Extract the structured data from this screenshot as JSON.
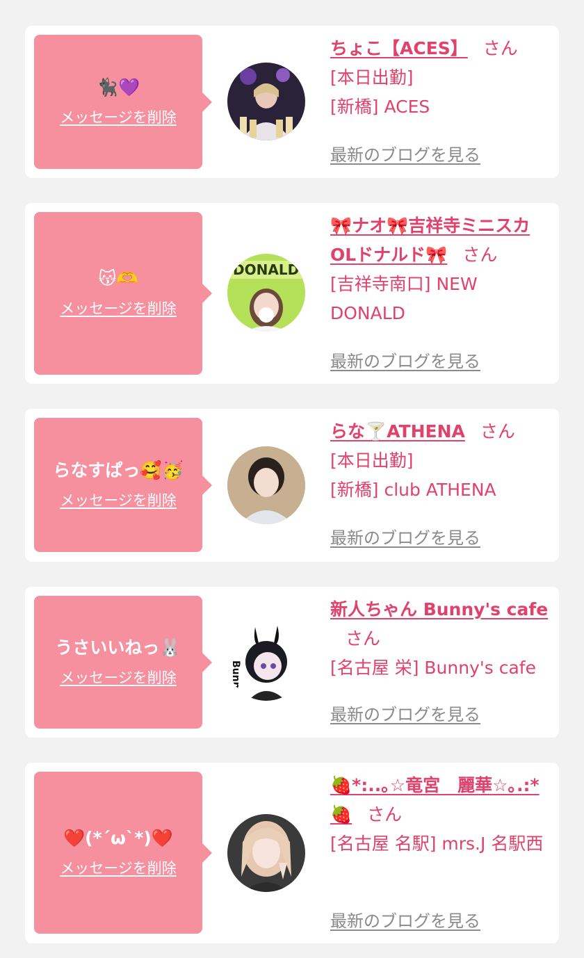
{
  "delete_label": "メッセージを削除",
  "blog_label": "最新のブログを見る",
  "san_label": "さん",
  "cards": [
    {
      "message": "🐈‍⬛💜",
      "name": "ちょこ【ACES】",
      "lines": [
        "[本日出勤]",
        "[新橋] ACES"
      ]
    },
    {
      "message": "😽🫶",
      "name": "🎀ナオ🎀吉祥寺ミニスカOLドナルド🎀",
      "lines": [
        "[吉祥寺南口] NEW DONALD"
      ]
    },
    {
      "message": "らなすぱっ🥰🥳",
      "name": "らな🍸ATHENA",
      "lines": [
        "[本日出勤]",
        "[新橋] club ATHENA"
      ]
    },
    {
      "message": "うさいいねっ🐰",
      "name": "新人ちゃん Bunny's cafe",
      "lines": [
        "[名古屋 栄] Bunny's cafe"
      ]
    },
    {
      "message": "❤️(*´ω`*)❤️",
      "name": "🍓*:..｡☆竜宮　麗華☆｡.:*🍓",
      "lines": [
        "[名古屋 名駅] mrs.J 名駅西"
      ]
    }
  ],
  "colors": {
    "page_bg": "#f2f2f2",
    "bubble": "#f6909f",
    "name_pink": "#e0426b",
    "blog_gray": "#8a8a8a"
  }
}
